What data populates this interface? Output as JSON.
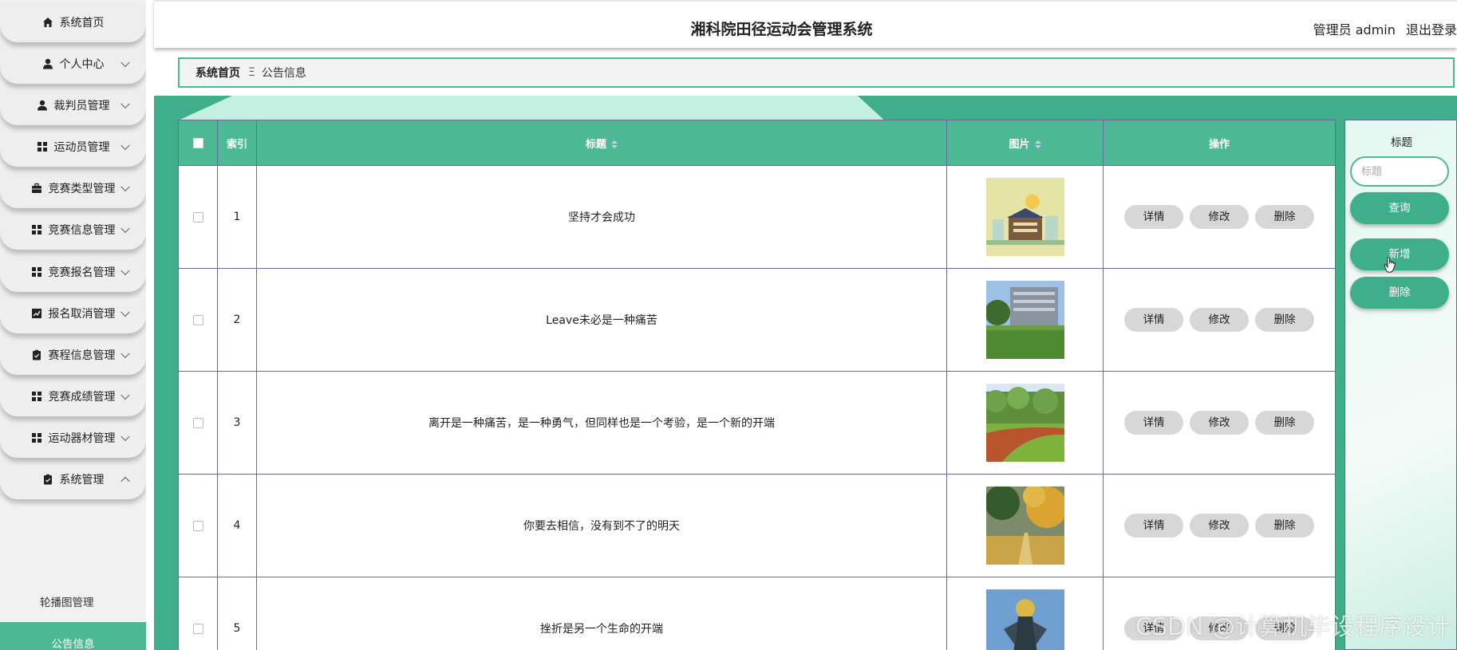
{
  "sidebar": {
    "items": [
      {
        "label": "系统首页",
        "icon": "home-icon",
        "chevron": ""
      },
      {
        "label": "个人中心",
        "icon": "user-icon",
        "chevron": "down"
      },
      {
        "label": "裁判员管理",
        "icon": "user-icon",
        "chevron": "down"
      },
      {
        "label": "运动员管理",
        "icon": "grid-icon",
        "chevron": "down"
      },
      {
        "label": "竞赛类型管理",
        "icon": "briefcase-icon",
        "chevron": "down"
      },
      {
        "label": "竞赛信息管理",
        "icon": "grid-icon",
        "chevron": "down"
      },
      {
        "label": "竞赛报名管理",
        "icon": "grid-icon",
        "chevron": "down"
      },
      {
        "label": "报名取消管理",
        "icon": "chart-icon",
        "chevron": "down"
      },
      {
        "label": "赛程信息管理",
        "icon": "clipboard-icon",
        "chevron": "down"
      },
      {
        "label": "竞赛成绩管理",
        "icon": "grid-icon",
        "chevron": "down"
      },
      {
        "label": "运动器材管理",
        "icon": "grid-icon",
        "chevron": "down"
      },
      {
        "label": "系统管理",
        "icon": "clipboard-icon",
        "chevron": "up"
      }
    ],
    "submenu": [
      {
        "label": "轮播图管理",
        "active": false
      },
      {
        "label": "公告信息",
        "active": true
      }
    ]
  },
  "header": {
    "title": "湘科院田径运动会管理系统",
    "user_role": "管理员 admin",
    "logout": "退出登录"
  },
  "breadcrumb": {
    "home": "系统首页",
    "separator": "Ξ",
    "current": "公告信息"
  },
  "table": {
    "columns": [
      "索引",
      "标题",
      "图片",
      "操作"
    ],
    "rows": [
      {
        "index": "1",
        "title": "坚持才会成功",
        "image": "campus-building-illustration"
      },
      {
        "index": "2",
        "title": "Leave未必是一种痛苦",
        "image": "campus-building-lawn-photo"
      },
      {
        "index": "3",
        "title": "离开是一种痛苦，是一种勇气，但同样也是一个考验，是一个新的开端",
        "image": "running-track-photo"
      },
      {
        "index": "4",
        "title": "你要去相信，没有到不了的明天",
        "image": "autumn-path-photo"
      },
      {
        "index": "5",
        "title": "挫折是另一个生命的开端",
        "image": "sculpture-photo"
      }
    ],
    "actions": {
      "detail": "详情",
      "edit": "修改",
      "delete": "删除"
    }
  },
  "search_panel": {
    "label": "标题",
    "placeholder": "标题",
    "query_button": "查询",
    "add_button": "新增",
    "delete_button": "删除"
  },
  "watermark": "CSDN @计算机毕设程序设计",
  "colors": {
    "accent": "#4db894",
    "accent_dark": "#3fae8a",
    "action_button": "#d7d7d7"
  }
}
